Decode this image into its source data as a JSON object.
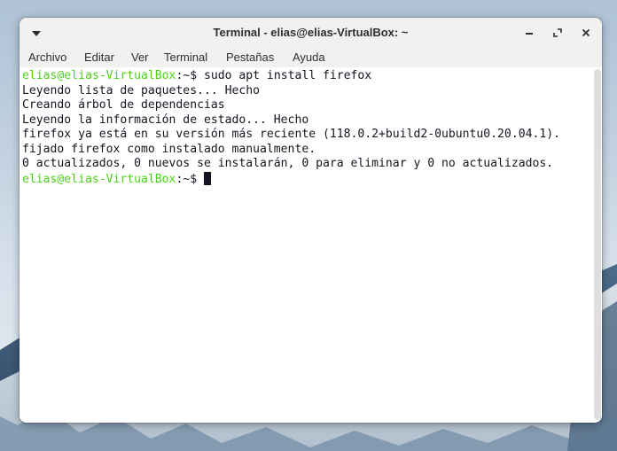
{
  "window": {
    "title": "Terminal - elias@elias-VirtualBox: ~",
    "menu_icon": "chevron-down-icon",
    "minimize_icon": "minimize-icon",
    "maximize_icon": "maximize-icon",
    "close_icon": "close-icon"
  },
  "menubar": [
    "Archivo",
    "Editar",
    "Ver",
    "Terminal",
    "Pestañas",
    "Ayuda"
  ],
  "terminal": {
    "prompt_user": "elias@elias-VirtualBox",
    "prompt_path": ":~$ ",
    "command": "sudo apt install firefox",
    "output": [
      "Leyendo lista de paquetes... Hecho",
      "Creando árbol de dependencias",
      "Leyendo la información de estado... Hecho",
      "firefox ya está en su versión más reciente (118.0.2+build2-0ubuntu0.20.04.1).",
      "fijado firefox como instalado manualmente.",
      "0 actualizados, 0 nuevos se instalarán, 0 para eliminar y 0 no actualizados."
    ]
  },
  "colors": {
    "prompt_green": "#4cd319",
    "terminal_fg": "#171421",
    "terminal_bg": "#ffffff"
  }
}
